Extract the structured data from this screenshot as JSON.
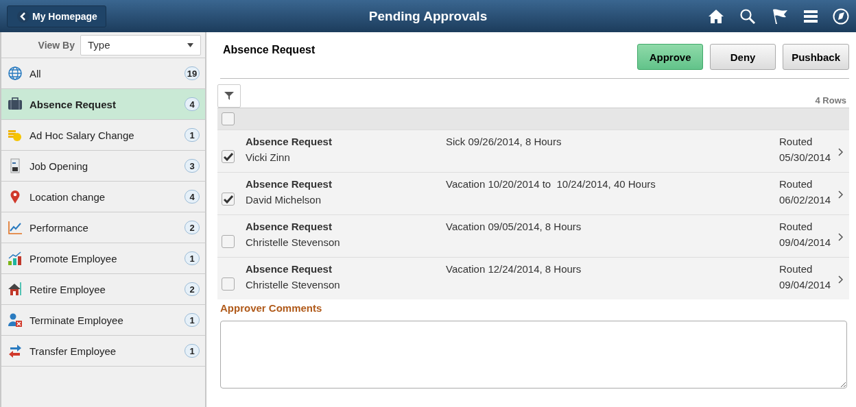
{
  "header": {
    "back_label": "My Homepage",
    "title": "Pending Approvals"
  },
  "sidebar": {
    "view_by_label": "View By",
    "view_by_value": "Type",
    "items": [
      {
        "label": "All",
        "count": "19",
        "selected": false
      },
      {
        "label": "Absence Request",
        "count": "4",
        "selected": true
      },
      {
        "label": "Ad Hoc Salary Change",
        "count": "1",
        "selected": false
      },
      {
        "label": "Job Opening",
        "count": "3",
        "selected": false
      },
      {
        "label": "Location change",
        "count": "4",
        "selected": false
      },
      {
        "label": "Performance",
        "count": "2",
        "selected": false
      },
      {
        "label": "Promote Employee",
        "count": "1",
        "selected": false
      },
      {
        "label": "Retire Employee",
        "count": "2",
        "selected": false
      },
      {
        "label": "Terminate Employee",
        "count": "1",
        "selected": false
      },
      {
        "label": "Transfer Employee",
        "count": "1",
        "selected": false
      }
    ]
  },
  "main": {
    "title": "Absence Request",
    "buttons": [
      {
        "label": "Approve",
        "kind": "primary"
      },
      {
        "label": "Deny",
        "kind": "secondary"
      },
      {
        "label": "Pushback",
        "kind": "secondary"
      }
    ],
    "row_count": "4 Rows",
    "select_all_checked": false,
    "rows": [
      {
        "type": "Absence Request",
        "name": "Vicki Zinn",
        "detail": "Sick 09/26/2014, 8 Hours",
        "status": "Routed",
        "date": "05/30/2014",
        "checked": true
      },
      {
        "type": "Absence Request",
        "name": "David Michelson",
        "detail": "Vacation 10/20/2014 to  10/24/2014, 40 Hours",
        "status": "Routed",
        "date": "06/02/2014",
        "checked": true
      },
      {
        "type": "Absence Request",
        "name": "Christelle Stevenson",
        "detail": "Vacation 09/05/2014, 8 Hours",
        "status": "Routed",
        "date": "09/04/2014",
        "checked": false
      },
      {
        "type": "Absence Request",
        "name": "Christelle Stevenson",
        "detail": "Vacation 12/24/2014, 8 Hours",
        "status": "Routed",
        "date": "09/04/2014",
        "checked": false
      }
    ],
    "comments_label": "Approver Comments"
  }
}
